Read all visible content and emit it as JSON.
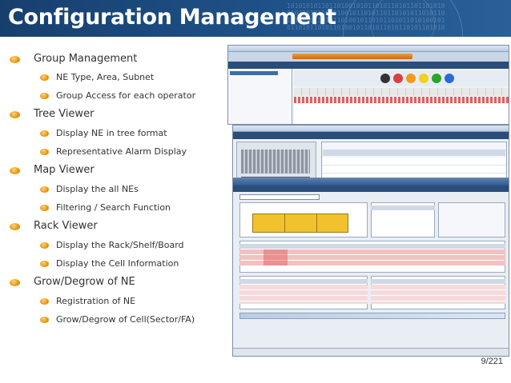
{
  "slide": {
    "title": "Configuration Management",
    "page_number": "9/221",
    "binary_pattern": "10101010110110100101011010110101101101010\n01011010110101001011010110110101011010110\n10110101101011010010110101101011010100101\n01101011010110100101101011010110101101010"
  },
  "bullets": [
    {
      "label": "Group Management",
      "sub": [
        "NE Type, Area, Subnet",
        "Group Access for each operator"
      ]
    },
    {
      "label": "Tree Viewer",
      "sub": [
        "Display NE in tree format",
        "Representative Alarm Display"
      ]
    },
    {
      "label": "Map Viewer",
      "sub": [
        "Display the all NEs",
        "Filtering / Search Function"
      ]
    },
    {
      "label": "Rack Viewer",
      "sub": [
        "Display the Rack/Shelf/Board",
        "Display the Cell Information"
      ]
    },
    {
      "label": "Grow/Degrow of NE",
      "sub": [
        "Registration of NE",
        "Grow/Degrow of Cell(Sector/FA)"
      ]
    }
  ],
  "colors": {
    "banner": "#1f5289",
    "bullet": "#f0a020",
    "sector_fill": "#f2c12e",
    "alarm_red": "#e06060",
    "alarm_pink": "#f4c0c0"
  }
}
